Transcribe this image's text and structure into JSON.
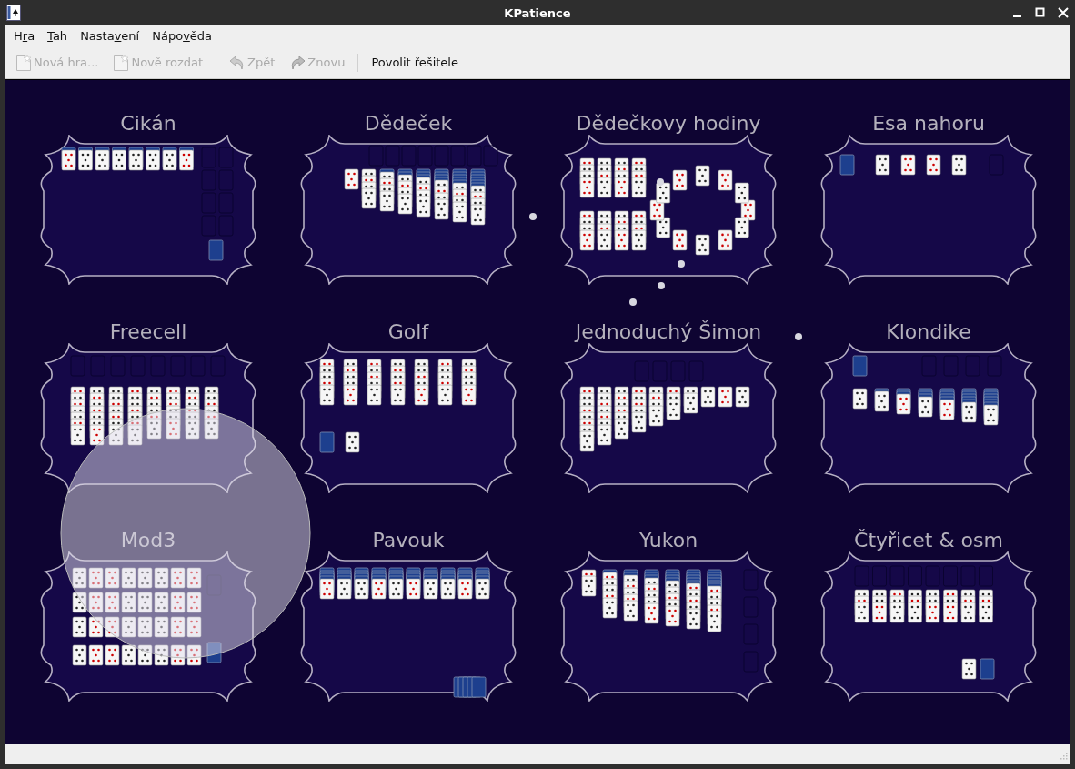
{
  "window": {
    "title": "KPatience"
  },
  "menu": [
    {
      "before": "H",
      "key": "r",
      "after": "a"
    },
    {
      "key": "T",
      "after": "ah"
    },
    {
      "before": "Nasta",
      "key": "v",
      "after": "ení"
    },
    {
      "before": "Nápo",
      "key": "v",
      "after": "ěda"
    }
  ],
  "toolbar": [
    {
      "kind": "button",
      "label": "Nová hra...",
      "disabled": true
    },
    {
      "kind": "button",
      "label": "Nově rozdat",
      "disabled": true
    },
    {
      "kind": "separator"
    },
    {
      "kind": "button",
      "label": "Zpět",
      "disabled": true
    },
    {
      "kind": "button",
      "label": "Znovu",
      "disabled": true
    },
    {
      "kind": "separator"
    },
    {
      "kind": "button",
      "label": "Povolit řešitele",
      "disabled": false
    }
  ],
  "games": [
    {
      "title": "Cikán"
    },
    {
      "title": "Dědeček"
    },
    {
      "title": "Dědečkovy hodiny"
    },
    {
      "title": "Esa nahoru"
    },
    {
      "title": "Freecell"
    },
    {
      "title": "Golf"
    },
    {
      "title": "Jednoduchý Šimon"
    },
    {
      "title": "Klondike"
    },
    {
      "title": "Mod3"
    },
    {
      "title": "Pavouk"
    },
    {
      "title": "Yukon"
    },
    {
      "title": "Čtyřicet & osm"
    }
  ]
}
